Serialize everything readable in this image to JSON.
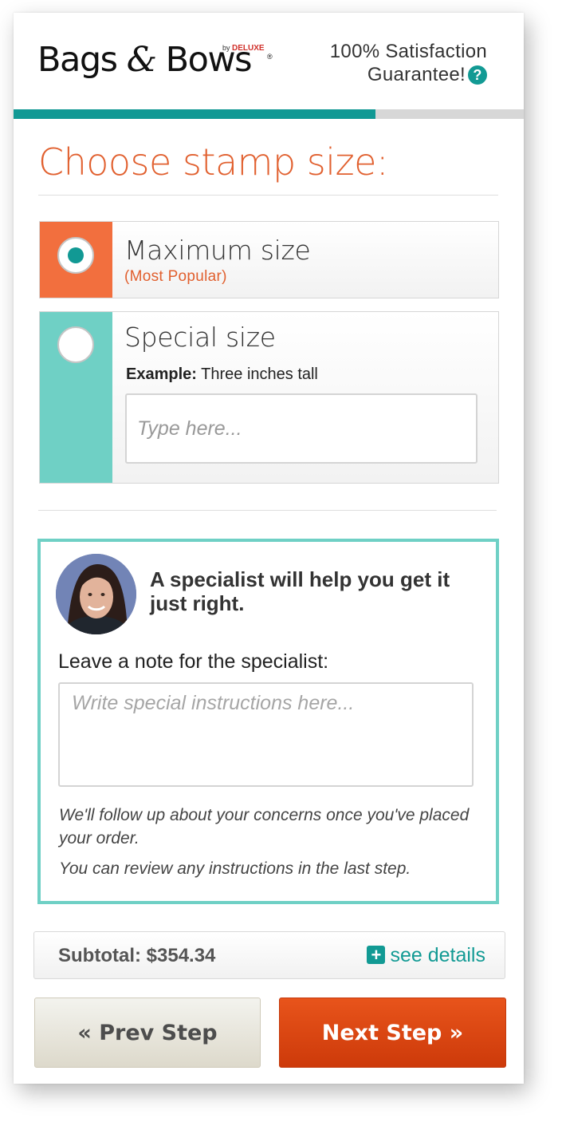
{
  "header": {
    "brand_name": "Bags & Bows",
    "brand_by": "by",
    "brand_parent": "DELUXE",
    "brand_reg_mark": "®",
    "guarantee_line1": "100% Satisfaction",
    "guarantee_line2": "Guarantee!",
    "help_glyph": "?"
  },
  "progress": {
    "fraction": 0.71,
    "fill_color": "#119994",
    "track_color": "#d7d7d7"
  },
  "title": "Choose stamp size:",
  "options": [
    {
      "label": "Maximum size",
      "sublabel": "(Most Popular)",
      "selected": true,
      "side_color": "#f26f3e"
    },
    {
      "label": "Special size",
      "example_label": "Example:",
      "example_text": "Three inches tall",
      "input_placeholder": "Type here...",
      "input_value": "",
      "selected": false,
      "side_color": "#6fd0c5"
    }
  ],
  "specialist": {
    "heading": "A specialist will help you get it just right.",
    "note_label": "Leave a note for the specialist:",
    "note_placeholder": "Write special instructions here...",
    "note_value": "",
    "followup_text": "We'll follow up about your concerns once you've placed your order.",
    "review_text": "You can review any instructions in the last step.",
    "border_color": "#6fd0c5"
  },
  "footer": {
    "subtotal_label": "Subtotal: $354.34",
    "details_icon": "plus-square-icon",
    "details_label": "see details",
    "prev_label": "« Prev Step",
    "next_label": "Next Step »"
  },
  "colors": {
    "accent": "#119994",
    "brand_orange": "#e1602f",
    "cta": "#d9430f"
  }
}
